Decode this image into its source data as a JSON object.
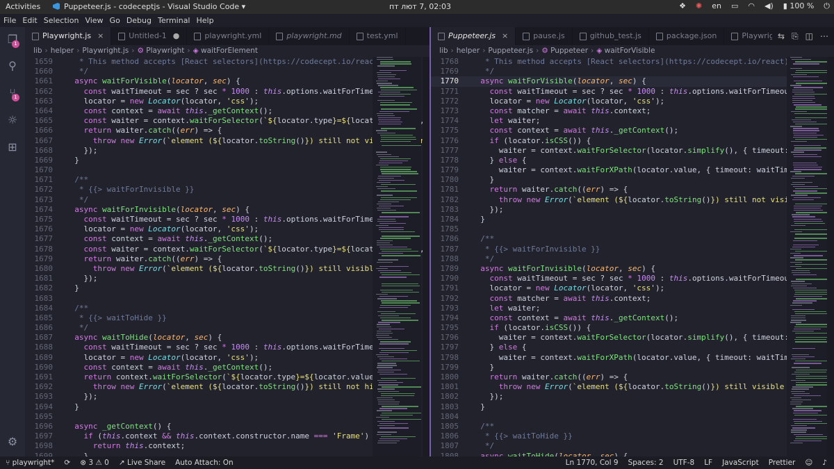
{
  "topbar": {
    "activities": "Activities",
    "window_title": "Puppeteer.js - codeceptjs - Visual Studio Code",
    "dropdown": "▾",
    "clock": "пт лют  7, 02:03",
    "lang": "en",
    "battery": "100 %",
    "tray_icons": [
      "dropbox-icon",
      "telegram-icon",
      "keyboard-icon",
      "window-icon",
      "wifi-icon",
      "volume-icon",
      "battery-icon",
      "power-icon"
    ]
  },
  "menu": [
    "File",
    "Edit",
    "Selection",
    "View",
    "Go",
    "Debug",
    "Terminal",
    "Help"
  ],
  "activity": {
    "explorer_badge": "1",
    "scm_badge": "1"
  },
  "left": {
    "tabs": [
      {
        "label": "Playwright.js",
        "active": true,
        "italic": false,
        "close": "×"
      },
      {
        "label": "Untitled-1",
        "active": false,
        "italic": false,
        "close": "●"
      },
      {
        "label": "playwright.yml",
        "active": false,
        "italic": false,
        "close": ""
      },
      {
        "label": "playwright.md",
        "active": false,
        "italic": true,
        "close": ""
      },
      {
        "label": "test.yml",
        "active": false,
        "italic": false,
        "close": ""
      }
    ],
    "breadcrumb": [
      "lib",
      "helper",
      "Playwright.js",
      "Playwright",
      "waitForElement"
    ],
    "lines": [
      {
        "n": "1659",
        "h": "<span class=\"c\">   * This method accepts [React selectors](https://codecept.io/react).</span>"
      },
      {
        "n": "1660",
        "h": "<span class=\"c\">   */</span>"
      },
      {
        "n": "1661",
        "h": "  <span class=\"k\">async</span> <span class=\"f\">waitForVisible</span>(<span class=\"p\">locator</span>, <span class=\"p\">sec</span>) {"
      },
      {
        "n": "1662",
        "h": "    <span class=\"k\">const</span> waitTimeout = sec ? sec <span class=\"k\">*</span> <span class=\"n\">1000</span> : <span class=\"t\">this</span>.options.waitForTimeout;"
      },
      {
        "n": "1663",
        "h": "    locator = <span class=\"k\">new</span> <span class=\"ty\">Locator</span>(locator, <span class=\"s\">'css'</span>);"
      },
      {
        "n": "1664",
        "h": "    <span class=\"k\">const</span> context = <span class=\"k\">await</span> <span class=\"t\">this</span>.<span class=\"f\">_getContext</span>();"
      },
      {
        "n": "1665",
        "h": "    <span class=\"k\">const</span> waiter = context.<span class=\"f\">waitForSelector</span>(<span class=\"s\">`${</span>locator.type<span class=\"s\">}=${</span>locator.value<span class=\"s\">}`</span>, {"
      },
      {
        "n": "1666",
        "h": "    <span class=\"k\">return</span> waiter.<span class=\"f\">catch</span>((<span class=\"p\">err</span>) => {"
      },
      {
        "n": "1667",
        "h": "      <span class=\"k\">throw</span> <span class=\"k\">new</span> <span class=\"ty\">Error</span>(<span class=\"s\">`element (${</span>locator.<span class=\"f\">toString</span>()<span class=\"s\">}) still not visible after</span>"
      },
      {
        "n": "1668",
        "h": "    });"
      },
      {
        "n": "1669",
        "h": "  }"
      },
      {
        "n": "1670",
        "h": ""
      },
      {
        "n": "1671",
        "h": "<span class=\"c\">  /**</span>"
      },
      {
        "n": "1672",
        "h": "<span class=\"c\">   * {{&gt; waitForInvisible }}</span>"
      },
      {
        "n": "1673",
        "h": "<span class=\"c\">   */</span>"
      },
      {
        "n": "1674",
        "h": "  <span class=\"k\">async</span> <span class=\"f\">waitForInvisible</span>(<span class=\"p\">locator</span>, <span class=\"p\">sec</span>) {"
      },
      {
        "n": "1675",
        "h": "    <span class=\"k\">const</span> waitTimeout = sec ? sec <span class=\"k\">*</span> <span class=\"n\">1000</span> : <span class=\"t\">this</span>.options.waitForTimeout;"
      },
      {
        "n": "1676",
        "h": "    locator = <span class=\"k\">new</span> <span class=\"ty\">Locator</span>(locator, <span class=\"s\">'css'</span>);"
      },
      {
        "n": "1677",
        "h": "    <span class=\"k\">const</span> context = <span class=\"k\">await</span> <span class=\"t\">this</span>.<span class=\"f\">_getContext</span>();"
      },
      {
        "n": "1678",
        "h": "    <span class=\"k\">const</span> waiter = context.<span class=\"f\">waitForSelector</span>(<span class=\"s\">`${</span>locator.type<span class=\"s\">}=${</span>locator.value<span class=\"s\">}`</span>, {"
      },
      {
        "n": "1679",
        "h": "    <span class=\"k\">return</span> waiter.<span class=\"f\">catch</span>((<span class=\"p\">err</span>) => {"
      },
      {
        "n": "1680",
        "h": "      <span class=\"k\">throw</span> <span class=\"k\">new</span> <span class=\"ty\">Error</span>(<span class=\"s\">`element (${</span>locator.<span class=\"f\">toString</span>()<span class=\"s\">}) still visible after</span>"
      },
      {
        "n": "1681",
        "h": "    });"
      },
      {
        "n": "1682",
        "h": "  }"
      },
      {
        "n": "1683",
        "h": ""
      },
      {
        "n": "1684",
        "h": "<span class=\"c\">  /**</span>"
      },
      {
        "n": "1685",
        "h": "<span class=\"c\">   * {{&gt; waitToHide }}</span>"
      },
      {
        "n": "1686",
        "h": "<span class=\"c\">   */</span>"
      },
      {
        "n": "1687",
        "h": "  <span class=\"k\">async</span> <span class=\"f\">waitToHide</span>(<span class=\"p\">locator</span>, <span class=\"p\">sec</span>) {"
      },
      {
        "n": "1688",
        "h": "    <span class=\"k\">const</span> waitTimeout = sec ? sec <span class=\"k\">*</span> <span class=\"n\">1000</span> : <span class=\"t\">this</span>.options.waitForTimeout;"
      },
      {
        "n": "1689",
        "h": "    locator = <span class=\"k\">new</span> <span class=\"ty\">Locator</span>(locator, <span class=\"s\">'css'</span>);"
      },
      {
        "n": "1690",
        "h": "    <span class=\"k\">const</span> context = <span class=\"k\">await</span> <span class=\"t\">this</span>.<span class=\"f\">_getContext</span>();"
      },
      {
        "n": "1691",
        "h": "    <span class=\"k\">return</span> context.<span class=\"f\">waitForSelector</span>(<span class=\"s\">`${</span>locator.type<span class=\"s\">}=${</span>locator.value<span class=\"s\">}`</span>, { tim"
      },
      {
        "n": "1692",
        "h": "      <span class=\"k\">throw</span> <span class=\"k\">new</span> <span class=\"ty\">Error</span>(<span class=\"s\">`element (${</span>locator.<span class=\"f\">toString</span>()<span class=\"s\">}) still not hidden after</span>"
      },
      {
        "n": "1693",
        "h": "    });"
      },
      {
        "n": "1694",
        "h": "  }"
      },
      {
        "n": "1695",
        "h": ""
      },
      {
        "n": "1696",
        "h": "  <span class=\"k\">async</span> <span class=\"f\">_getContext</span>() {"
      },
      {
        "n": "1697",
        "h": "    <span class=\"k\">if</span> (<span class=\"t\">this</span>.context <span class=\"k\">&amp;&amp;</span> <span class=\"t\">this</span>.context.constructor.name <span class=\"k\">===</span> <span class=\"s\">'Frame'</span>) {"
      },
      {
        "n": "1698",
        "h": "      <span class=\"k\">return</span> <span class=\"t\">this</span>.context;"
      },
      {
        "n": "1699",
        "h": "    }"
      }
    ]
  },
  "right": {
    "tabs": [
      {
        "label": "Puppeteer.js",
        "active": true,
        "italic": true,
        "close": "×"
      },
      {
        "label": "pause.js",
        "active": false,
        "italic": false,
        "close": ""
      },
      {
        "label": "github_test.js",
        "active": false,
        "italic": false,
        "close": ""
      },
      {
        "label": "package.json",
        "active": false,
        "italic": false,
        "close": ""
      },
      {
        "label": "Playwright",
        "active": false,
        "italic": false,
        "close": ""
      }
    ],
    "breadcrumb": [
      "lib",
      "helper",
      "Puppeteer.js",
      "Puppeteer",
      "waitForVisible"
    ],
    "lines": [
      {
        "n": "1768",
        "h": "<span class=\"c\">   * This method accepts [React selectors](https://codecept.io/react).</span>"
      },
      {
        "n": "1769",
        "h": "<span class=\"c\">   */</span>"
      },
      {
        "n": "1770",
        "h": "  <span class=\"k\">async</span> <span class=\"f\">waitForVisible</span>(<span class=\"p\">locator</span>, <span class=\"p\">sec</span>) {",
        "cur": true
      },
      {
        "n": "1771",
        "h": "    <span class=\"k\">const</span> waitTimeout = sec ? sec <span class=\"k\">*</span> <span class=\"n\">1000</span> : <span class=\"t\">this</span>.options.waitForTimeout;"
      },
      {
        "n": "1772",
        "h": "    locator = <span class=\"k\">new</span> <span class=\"ty\">Locator</span>(locator, <span class=\"s\">'css'</span>);"
      },
      {
        "n": "1773",
        "h": "    <span class=\"k\">const</span> matcher = <span class=\"k\">await</span> <span class=\"t\">this</span>.context;"
      },
      {
        "n": "1774",
        "h": "    <span class=\"k\">let</span> waiter;"
      },
      {
        "n": "1775",
        "h": "    <span class=\"k\">const</span> context = <span class=\"k\">await</span> <span class=\"t\">this</span>.<span class=\"f\">_getContext</span>();"
      },
      {
        "n": "1776",
        "h": "    <span class=\"k\">if</span> (locator.<span class=\"f\">isCSS</span>()) {"
      },
      {
        "n": "1777",
        "h": "      waiter = context.<span class=\"f\">waitForSelector</span>(locator.<span class=\"f\">simplify</span>(), { timeout: waitTim"
      },
      {
        "n": "1778",
        "h": "    } <span class=\"k\">else</span> {"
      },
      {
        "n": "1779",
        "h": "      waiter = context.<span class=\"f\">waitForXPath</span>(locator.value, { timeout: waitTimeout, vi"
      },
      {
        "n": "1780",
        "h": "    }"
      },
      {
        "n": "1781",
        "h": "    <span class=\"k\">return</span> waiter.<span class=\"f\">catch</span>((<span class=\"p\">err</span>) => {"
      },
      {
        "n": "1782",
        "h": "      <span class=\"k\">throw</span> <span class=\"k\">new</span> <span class=\"ty\">Error</span>(<span class=\"s\">`element (${</span>locator.<span class=\"f\">toString</span>()<span class=\"s\">}) still not visible after</span>"
      },
      {
        "n": "1783",
        "h": "    });"
      },
      {
        "n": "1784",
        "h": "  }"
      },
      {
        "n": "1785",
        "h": ""
      },
      {
        "n": "1786",
        "h": "<span class=\"c\">  /**</span>"
      },
      {
        "n": "1787",
        "h": "<span class=\"c\">   * {{&gt; waitForInvisible }}</span>"
      },
      {
        "n": "1788",
        "h": "<span class=\"c\">   */</span>"
      },
      {
        "n": "1789",
        "h": "  <span class=\"k\">async</span> <span class=\"f\">waitForInvisible</span>(<span class=\"p\">locator</span>, <span class=\"p\">sec</span>) {"
      },
      {
        "n": "1790",
        "h": "    <span class=\"k\">const</span> waitTimeout = sec ? sec <span class=\"k\">*</span> <span class=\"n\">1000</span> : <span class=\"t\">this</span>.options.waitForTimeout;"
      },
      {
        "n": "1791",
        "h": "    locator = <span class=\"k\">new</span> <span class=\"ty\">Locator</span>(locator, <span class=\"s\">'css'</span>);"
      },
      {
        "n": "1792",
        "h": "    <span class=\"k\">const</span> matcher = <span class=\"k\">await</span> <span class=\"t\">this</span>.context;"
      },
      {
        "n": "1793",
        "h": "    <span class=\"k\">let</span> waiter;"
      },
      {
        "n": "1794",
        "h": "    <span class=\"k\">const</span> context = <span class=\"k\">await</span> <span class=\"t\">this</span>.<span class=\"f\">_getContext</span>();"
      },
      {
        "n": "1795",
        "h": "    <span class=\"k\">if</span> (locator.<span class=\"f\">isCSS</span>()) {"
      },
      {
        "n": "1796",
        "h": "      waiter = context.<span class=\"f\">waitForSelector</span>(locator.<span class=\"f\">simplify</span>(), { timeout: wai"
      },
      {
        "n": "1797",
        "h": "    } <span class=\"k\">else</span> {"
      },
      {
        "n": "1798",
        "h": "      waiter = context.<span class=\"f\">waitForXPath</span>(locator.value, { timeout: waitTimeout, hi"
      },
      {
        "n": "1799",
        "h": "    }"
      },
      {
        "n": "1800",
        "h": "    <span class=\"k\">return</span> waiter.<span class=\"f\">catch</span>((<span class=\"p\">err</span>) => {"
      },
      {
        "n": "1801",
        "h": "      <span class=\"k\">throw</span> <span class=\"k\">new</span> <span class=\"ty\">Error</span>(<span class=\"s\">`element (${</span>locator.<span class=\"f\">toString</span>()<span class=\"s\">}) still visible after</span>"
      },
      {
        "n": "1802",
        "h": "    });"
      },
      {
        "n": "1803",
        "h": "  }"
      },
      {
        "n": "1804",
        "h": ""
      },
      {
        "n": "1805",
        "h": "<span class=\"c\">  /**</span>"
      },
      {
        "n": "1806",
        "h": "<span class=\"c\">   * {{&gt; waitToHide }}</span>"
      },
      {
        "n": "1807",
        "h": "<span class=\"c\">   */</span>"
      },
      {
        "n": "1808",
        "h": "  <span class=\"k\">async</span> <span class=\"f\">waitToHide</span>(<span class=\"p\">locator</span>, <span class=\"p\">sec</span>) {"
      }
    ]
  },
  "status": {
    "branch": "playwright*",
    "errors": "3",
    "warnings": "0",
    "live_share": "Live Share",
    "auto_attach": "Auto Attach: On",
    "position": "Ln 1770, Col 9",
    "spaces": "Spaces: 2",
    "encoding": "UTF-8",
    "eol": "LF",
    "language": "JavaScript",
    "formatter": "Prettier"
  }
}
